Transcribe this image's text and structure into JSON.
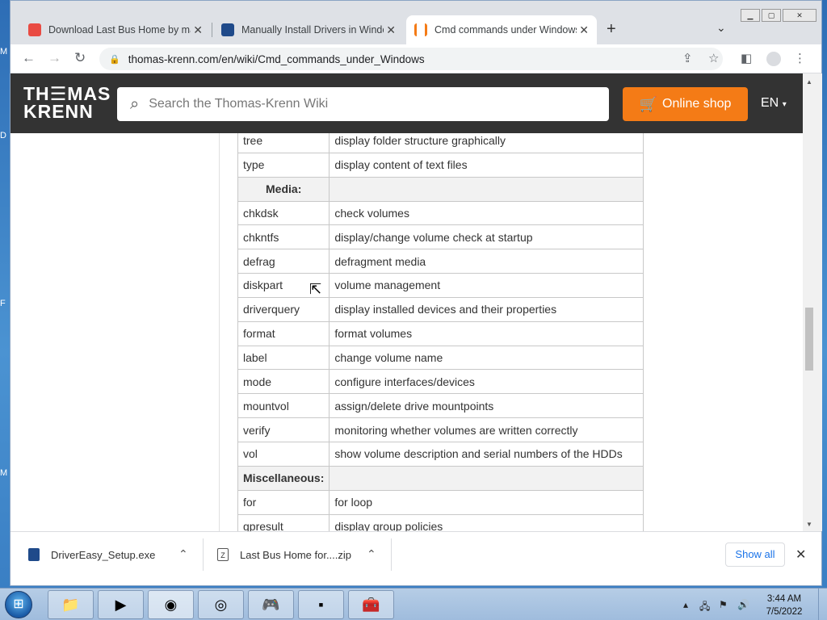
{
  "browser": {
    "tabs": [
      {
        "title": "Download Last Bus Home by maj",
        "favicon_color": "#e94b43",
        "favicon": "game-icon"
      },
      {
        "title": "Manually Install Drivers in Windo",
        "favicon_color": "#1f4a8a",
        "favicon": "drivereasy-icon"
      },
      {
        "title": "Cmd commands under Windows",
        "favicon_color": "#f47b16",
        "favicon": "thomas-krenn-icon",
        "active": true
      }
    ],
    "url": "thomas-krenn.com/en/wiki/Cmd_commands_under_Windows"
  },
  "site": {
    "logo_line1": "TH☰MAS",
    "logo_line2": "KRENN",
    "search_placeholder": "Search the Thomas-Krenn Wiki",
    "shop_label": "Online shop",
    "lang_label": "EN"
  },
  "table": {
    "rows": [
      {
        "cmd": "tree",
        "desc": "display folder structure graphically"
      },
      {
        "cmd": "type",
        "desc": "display content of text files"
      },
      {
        "cmd": "Media:",
        "desc": "",
        "header": true
      },
      {
        "cmd": "chkdsk",
        "desc": "check volumes"
      },
      {
        "cmd": "chkntfs",
        "desc": "display/change volume check at startup"
      },
      {
        "cmd": "defrag",
        "desc": "defragment media"
      },
      {
        "cmd": "diskpart",
        "desc": "volume management"
      },
      {
        "cmd": "driverquery",
        "desc": "display installed devices and their properties"
      },
      {
        "cmd": "format",
        "desc": "format volumes"
      },
      {
        "cmd": "label",
        "desc": "change volume name"
      },
      {
        "cmd": "mode",
        "desc": "configure interfaces/devices"
      },
      {
        "cmd": "mountvol",
        "desc": "assign/delete drive mountpoints"
      },
      {
        "cmd": "verify",
        "desc": "monitoring whether volumes are written correctly"
      },
      {
        "cmd": "vol",
        "desc": "show volume description and serial numbers of the HDDs"
      },
      {
        "cmd": "Miscellaneous:",
        "desc": "",
        "header": true
      },
      {
        "cmd": "for",
        "desc": "for loop"
      },
      {
        "cmd": "gpresult",
        "desc": "display group policies"
      }
    ]
  },
  "downloads": {
    "items": [
      {
        "name": "DriverEasy_Setup.exe",
        "icon": "drivereasy-file-icon"
      },
      {
        "name": "Last Bus Home for....zip",
        "icon": "zip-file-icon"
      }
    ],
    "show_all_label": "Show all"
  },
  "taskbar": {
    "time": "3:44 AM",
    "date": "7/5/2022",
    "apps": [
      "explorer-icon",
      "media-player-icon",
      "chrome-icon",
      "driver-app-icon",
      "game-app-icon",
      "cmd-icon",
      "toolbox-icon"
    ]
  }
}
